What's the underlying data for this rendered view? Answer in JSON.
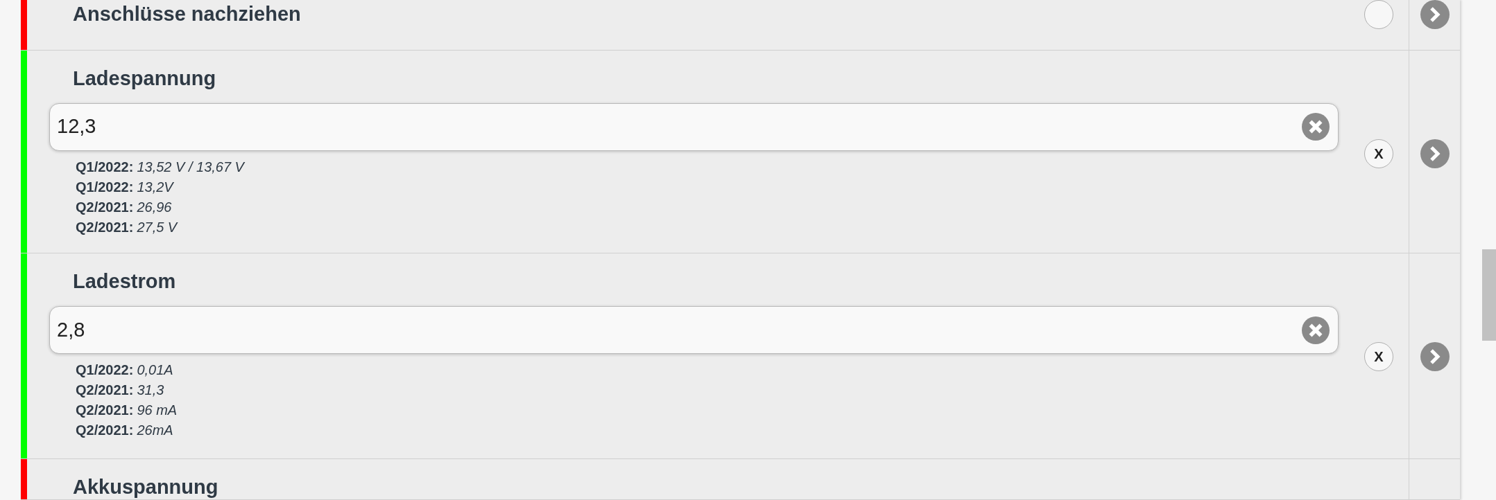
{
  "rows": [
    {
      "title": "Anschlüsse nachziehen",
      "color": "#ff0000",
      "kind": "check"
    },
    {
      "title": "Ladespannung",
      "color": "#00ff00",
      "kind": "input",
      "value": "12,3",
      "reset_label": "X",
      "history": [
        {
          "period": "Q1/2022:",
          "value": "13,52 V / 13,67 V"
        },
        {
          "period": "Q1/2022:",
          "value": "13,2V"
        },
        {
          "period": "Q2/2021:",
          "value": "26,96"
        },
        {
          "period": "Q2/2021:",
          "value": "27,5 V"
        }
      ]
    },
    {
      "title": "Ladestrom",
      "color": "#00ff00",
      "kind": "input",
      "value": "2,8",
      "reset_label": "X",
      "history": [
        {
          "period": "Q1/2022:",
          "value": "0,01A"
        },
        {
          "period": "Q2/2021:",
          "value": "31,3"
        },
        {
          "period": "Q2/2021:",
          "value": "96 mA"
        },
        {
          "period": "Q2/2021:",
          "value": "26mA"
        }
      ]
    },
    {
      "title": "Akkuspannung",
      "color": "#ff0000"
    }
  ]
}
